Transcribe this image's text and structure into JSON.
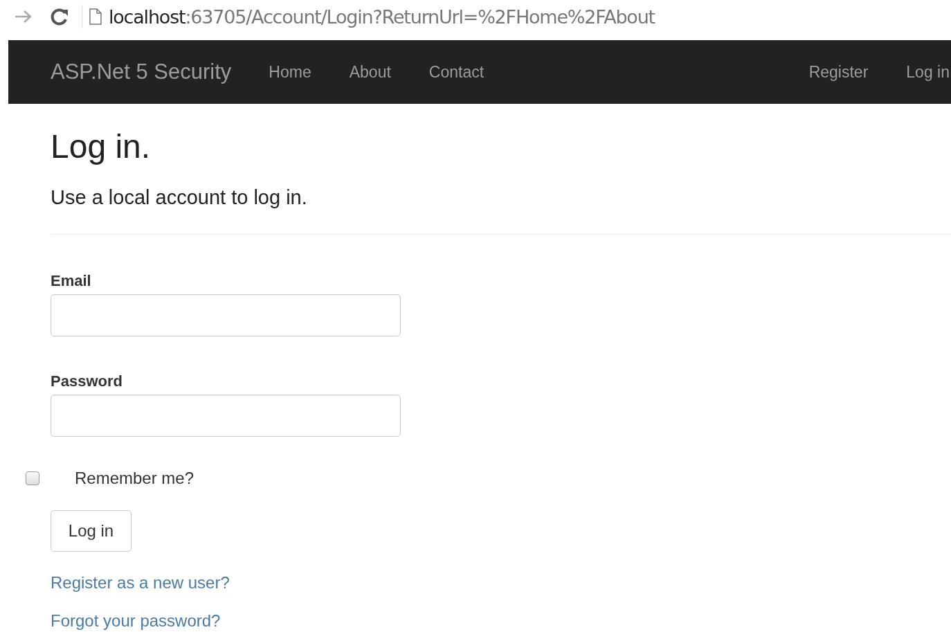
{
  "browser": {
    "address": {
      "host": "localhost",
      "path": ":63705/Account/Login?ReturnUrl=%2FHome%2FAbout"
    }
  },
  "navbar": {
    "brand": "ASP.Net 5 Security",
    "left_links": [
      "Home",
      "About",
      "Contact"
    ],
    "right_links": [
      "Register",
      "Log in"
    ]
  },
  "page": {
    "title": "Log in.",
    "subtitle": "Use a local account to log in.",
    "fields": [
      {
        "label": "Email"
      },
      {
        "label": "Password"
      }
    ],
    "remember": {
      "label": "Remember me?",
      "checked": false
    },
    "submit": "Log in",
    "links": [
      "Register as a new user?",
      "Forgot your password?"
    ]
  }
}
